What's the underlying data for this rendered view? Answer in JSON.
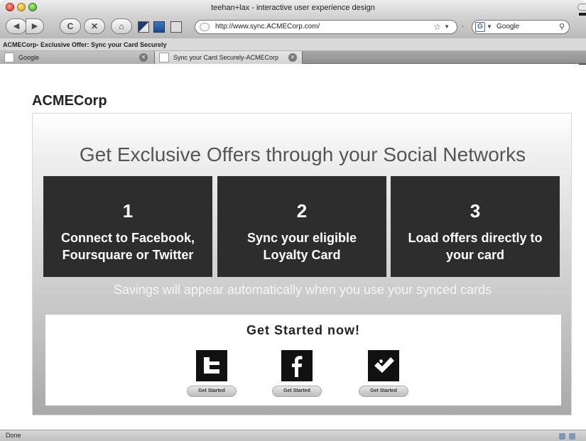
{
  "window": {
    "title": "teehan+lax - interactive user experience design"
  },
  "toolbar": {
    "url": "http://www.sync.ACMECorp.com/",
    "search_value": "Google",
    "search_engine_letter": "G"
  },
  "bookmarks_bar": {
    "text": "ACMECorp- Exclusive Offer: Sync your Card Securely"
  },
  "tabs": [
    {
      "label": "Google"
    },
    {
      "label": "Sync your Card Securely-ACMECorp"
    }
  ],
  "page": {
    "brand": "ACMECorp",
    "headline": "Get Exclusive Offers through your Social Networks",
    "steps": [
      {
        "number": "1",
        "text": "Connect to Facebook, Foursquare or Twitter"
      },
      {
        "number": "2",
        "text": "Sync your eligible Loyalty Card"
      },
      {
        "number": "3",
        "text": "Load offers directly to your card"
      }
    ],
    "savings_text": "Savings will appear automatically when you use your synced cards",
    "get_started": {
      "title": "Get Started now!",
      "buttons": [
        {
          "network": "twitter",
          "icon": "twitter-icon",
          "label": "Get Started"
        },
        {
          "network": "facebook",
          "icon": "facebook-icon",
          "label": "Get Started"
        },
        {
          "network": "foursquare",
          "icon": "foursquare-icon",
          "label": "Get Started"
        }
      ]
    }
  },
  "status": {
    "text": "Done"
  }
}
